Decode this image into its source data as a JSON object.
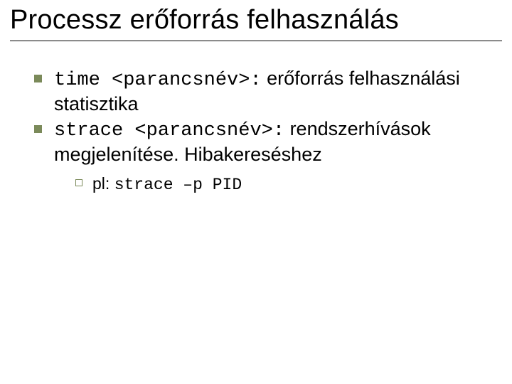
{
  "title": "Processz erőforrás felhasználás",
  "bullets": [
    {
      "code": "time <parancsnév>:",
      "rest": " erőforrás felhasználási statisztika"
    },
    {
      "code": "strace <parancsnév>:",
      "rest": " rendszerhívások megjelenítése. Hibakereséshez",
      "sub": [
        {
          "lead": "pl: ",
          "code": "strace –p PID"
        }
      ]
    }
  ]
}
